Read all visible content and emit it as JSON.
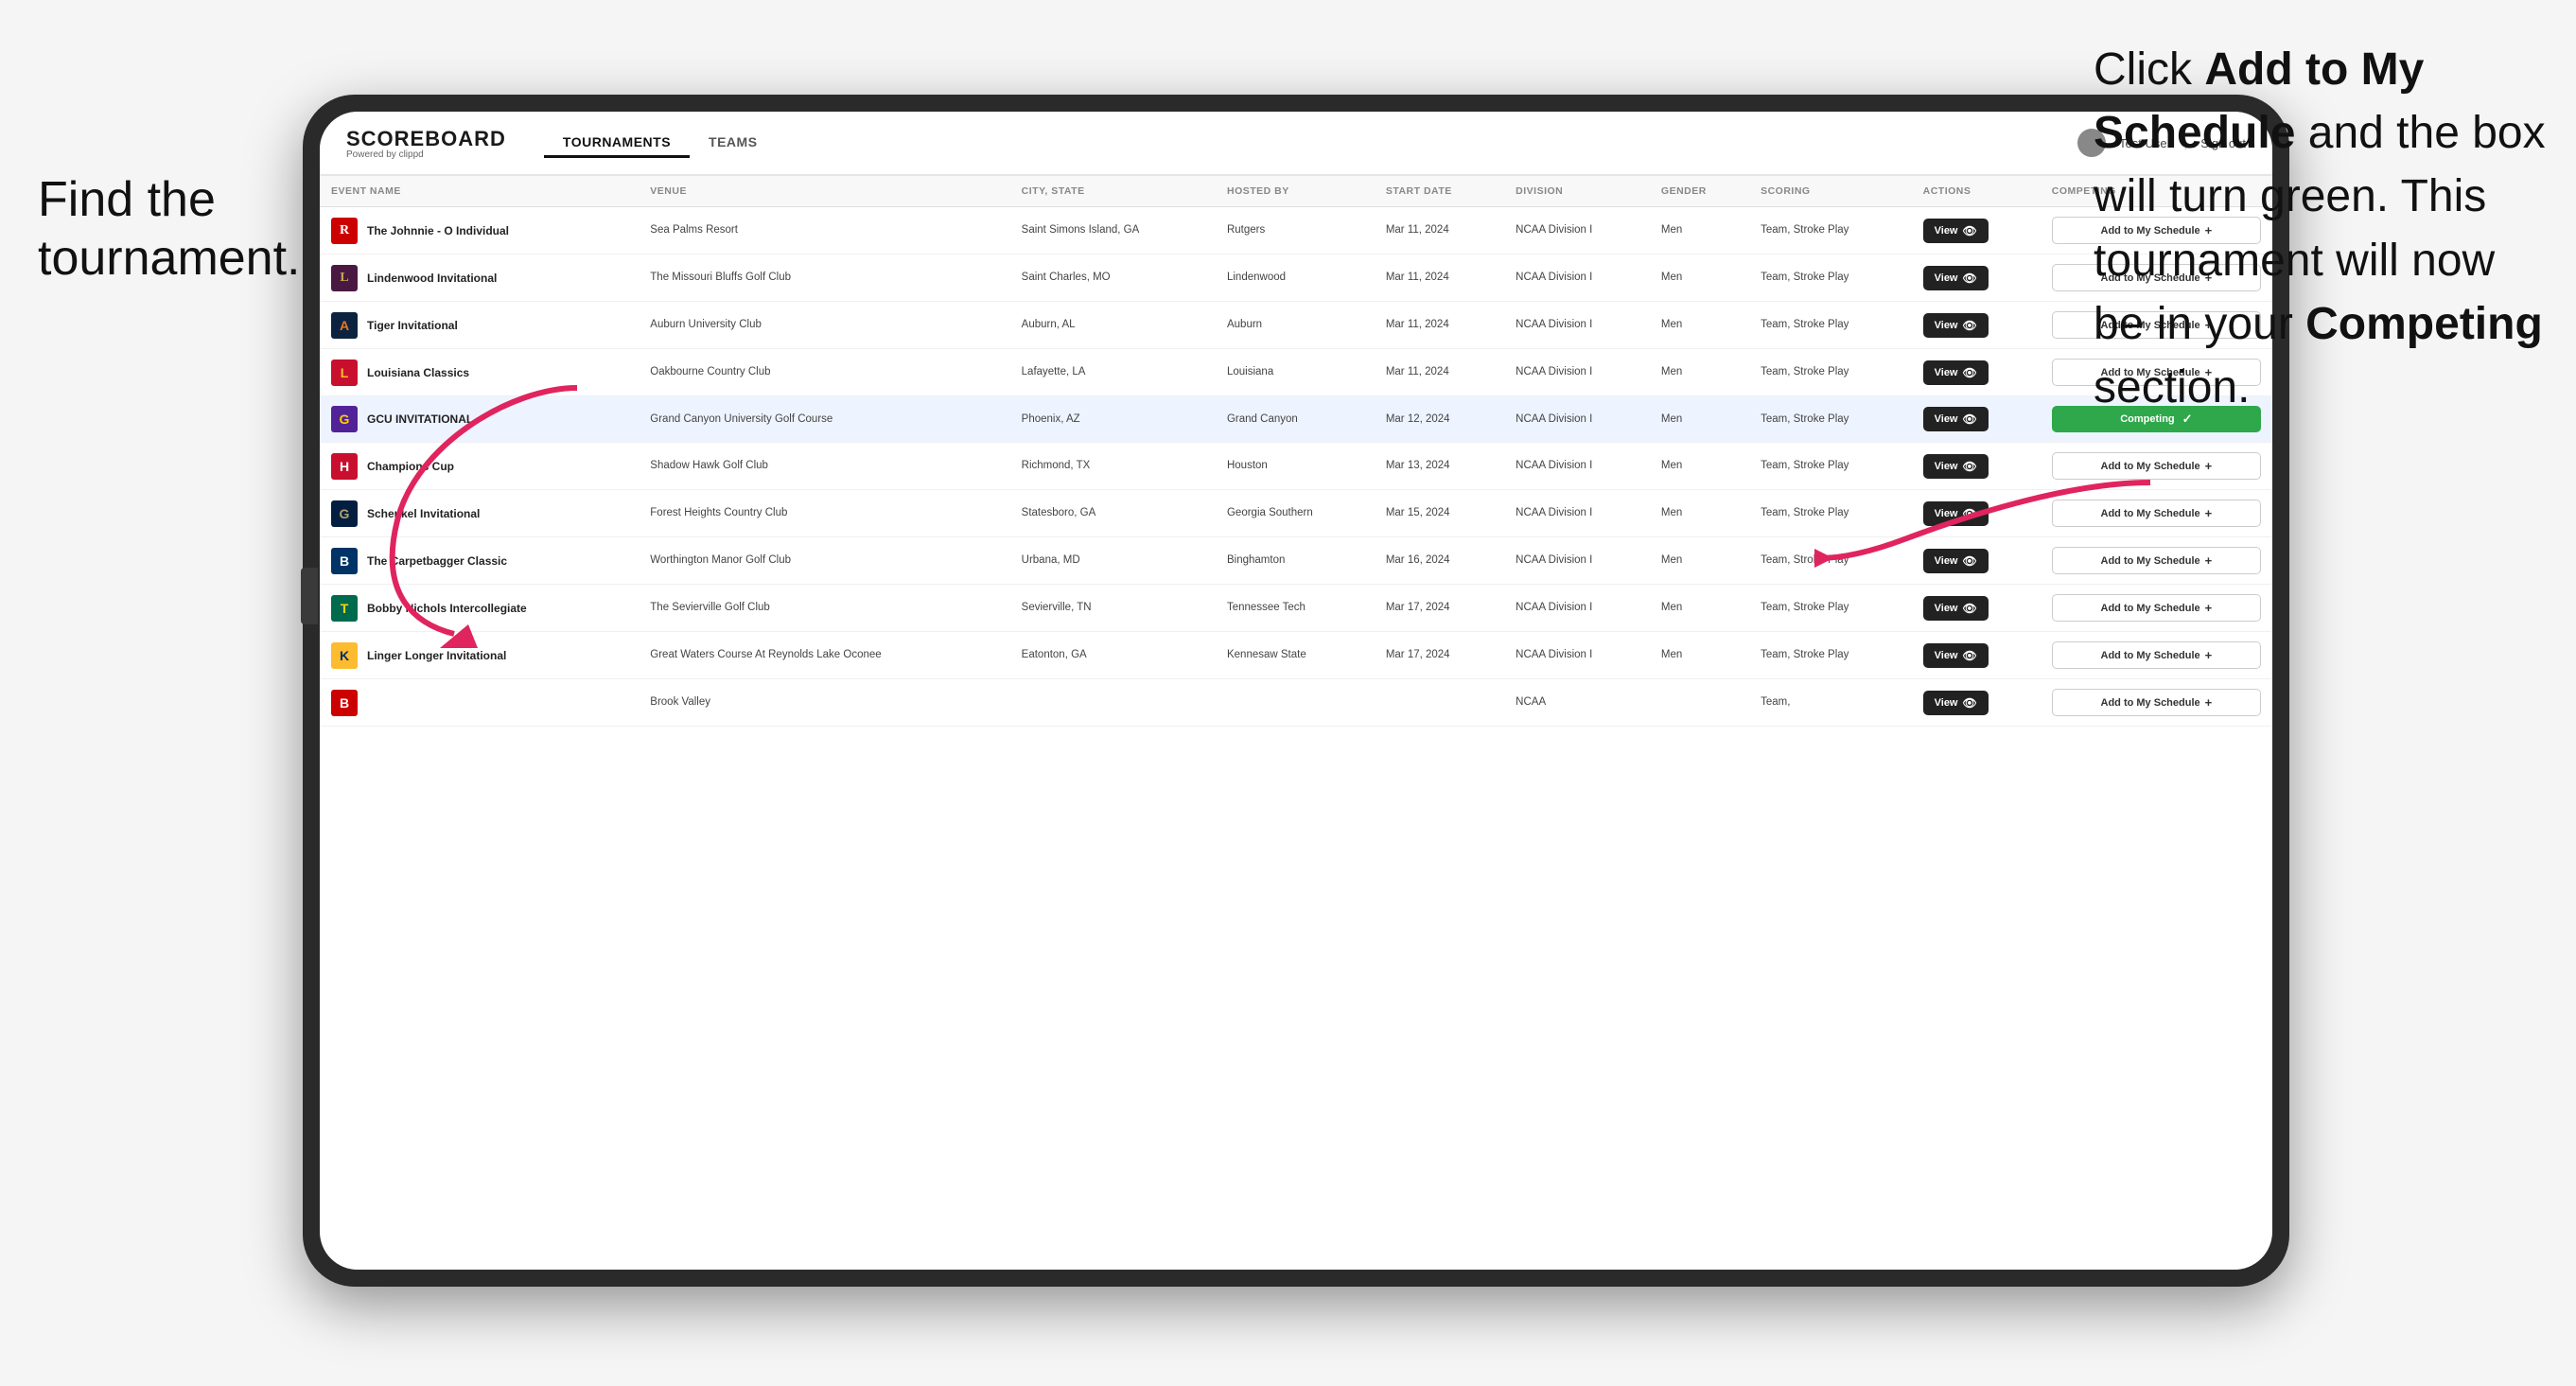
{
  "annotations": {
    "left": "Find the\ntournament.",
    "right_line1": "Click ",
    "right_bold1": "Add to My\nSchedule",
    "right_line2": " and the\nbox will turn green.\nThis tournament\nwill now be in\nyour ",
    "right_bold2": "Competing",
    "right_line3": " section."
  },
  "nav": {
    "logo": "SCOREBOARD",
    "logo_sub": "Powered by clippd",
    "tabs": [
      "TOURNAMENTS",
      "TEAMS"
    ],
    "active_tab": "TOURNAMENTS",
    "user_label": "Test User",
    "signout_label": "Sign out"
  },
  "table": {
    "columns": [
      "EVENT NAME",
      "VENUE",
      "CITY, STATE",
      "HOSTED BY",
      "START DATE",
      "DIVISION",
      "GENDER",
      "SCORING",
      "ACTIONS",
      "COMPETING"
    ],
    "rows": [
      {
        "id": 1,
        "logo_letter": "R",
        "logo_class": "logo-r",
        "event_name": "The Johnnie - O Individual",
        "venue": "Sea Palms Resort",
        "city_state": "Saint Simons Island, GA",
        "hosted_by": "Rutgers",
        "start_date": "Mar 11, 2024",
        "division": "NCAA Division I",
        "gender": "Men",
        "scoring": "Team, Stroke Play",
        "highlighted": false,
        "competing": false
      },
      {
        "id": 2,
        "logo_letter": "L",
        "logo_class": "logo-lindenwood",
        "event_name": "Lindenwood Invitational",
        "venue": "The Missouri Bluffs Golf Club",
        "city_state": "Saint Charles, MO",
        "hosted_by": "Lindenwood",
        "start_date": "Mar 11, 2024",
        "division": "NCAA Division I",
        "gender": "Men",
        "scoring": "Team, Stroke Play",
        "highlighted": false,
        "competing": false
      },
      {
        "id": 3,
        "logo_letter": "A",
        "logo_class": "logo-auburn",
        "event_name": "Tiger Invitational",
        "venue": "Auburn University Club",
        "city_state": "Auburn, AL",
        "hosted_by": "Auburn",
        "start_date": "Mar 11, 2024",
        "division": "NCAA Division I",
        "gender": "Men",
        "scoring": "Team, Stroke Play",
        "highlighted": false,
        "competing": false
      },
      {
        "id": 4,
        "logo_letter": "L",
        "logo_class": "logo-louisiana",
        "event_name": "Louisiana Classics",
        "venue": "Oakbourne Country Club",
        "city_state": "Lafayette, LA",
        "hosted_by": "Louisiana",
        "start_date": "Mar 11, 2024",
        "division": "NCAA Division I",
        "gender": "Men",
        "scoring": "Team, Stroke Play",
        "highlighted": false,
        "competing": false
      },
      {
        "id": 5,
        "logo_letter": "G",
        "logo_class": "logo-gcu",
        "event_name": "GCU INVITATIONAL",
        "venue": "Grand Canyon University Golf Course",
        "city_state": "Phoenix, AZ",
        "hosted_by": "Grand Canyon",
        "start_date": "Mar 12, 2024",
        "division": "NCAA Division I",
        "gender": "Men",
        "scoring": "Team, Stroke Play",
        "highlighted": true,
        "competing": true
      },
      {
        "id": 6,
        "logo_letter": "H",
        "logo_class": "logo-houston",
        "event_name": "Champions Cup",
        "venue": "Shadow Hawk Golf Club",
        "city_state": "Richmond, TX",
        "hosted_by": "Houston",
        "start_date": "Mar 13, 2024",
        "division": "NCAA Division I",
        "gender": "Men",
        "scoring": "Team, Stroke Play",
        "highlighted": false,
        "competing": false
      },
      {
        "id": 7,
        "logo_letter": "G",
        "logo_class": "logo-georgia-southern",
        "event_name": "Schenkel Invitational",
        "venue": "Forest Heights Country Club",
        "city_state": "Statesboro, GA",
        "hosted_by": "Georgia Southern",
        "start_date": "Mar 15, 2024",
        "division": "NCAA Division I",
        "gender": "Men",
        "scoring": "Team, Stroke Play",
        "highlighted": false,
        "competing": false
      },
      {
        "id": 8,
        "logo_letter": "B",
        "logo_class": "logo-bingham",
        "event_name": "The Carpetbagger Classic",
        "venue": "Worthington Manor Golf Club",
        "city_state": "Urbana, MD",
        "hosted_by": "Binghamton",
        "start_date": "Mar 16, 2024",
        "division": "NCAA Division I",
        "gender": "Men",
        "scoring": "Team, Stroke Play",
        "highlighted": false,
        "competing": false
      },
      {
        "id": 9,
        "logo_letter": "T",
        "logo_class": "logo-tennessee",
        "event_name": "Bobby Nichols Intercollegiate",
        "venue": "The Sevierville Golf Club",
        "city_state": "Sevierville, TN",
        "hosted_by": "Tennessee Tech",
        "start_date": "Mar 17, 2024",
        "division": "NCAA Division I",
        "gender": "Men",
        "scoring": "Team, Stroke Play",
        "highlighted": false,
        "competing": false
      },
      {
        "id": 10,
        "logo_letter": "K",
        "logo_class": "logo-kennesaw",
        "event_name": "Linger Longer Invitational",
        "venue": "Great Waters Course At Reynolds Lake Oconee",
        "city_state": "Eatonton, GA",
        "hosted_by": "Kennesaw State",
        "start_date": "Mar 17, 2024",
        "division": "NCAA Division I",
        "gender": "Men",
        "scoring": "Team, Stroke Play",
        "highlighted": false,
        "competing": false
      },
      {
        "id": 11,
        "logo_letter": "B",
        "logo_class": "logo-last",
        "event_name": "",
        "venue": "Brook Valley",
        "city_state": "",
        "hosted_by": "",
        "start_date": "",
        "division": "NCAA",
        "gender": "",
        "scoring": "Team,",
        "highlighted": false,
        "competing": false,
        "partial": true
      }
    ],
    "view_btn_label": "View",
    "add_schedule_label": "Add to My Schedule",
    "competing_label": "Competing"
  }
}
